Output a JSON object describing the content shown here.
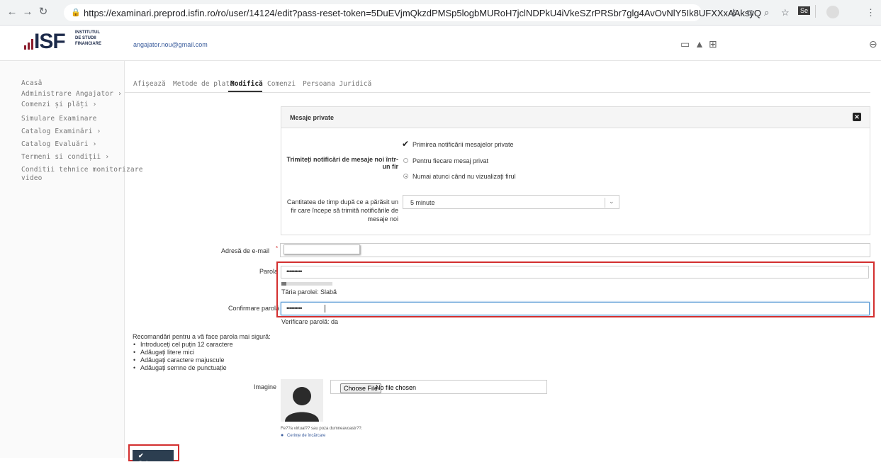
{
  "browser": {
    "url": "https://examinari.preprod.isfin.ro/ro/user/14124/edit?pass-reset-token=5DuEVjmQkzdPMSp5logbMURoH7jclNDPkU4iVkeSZrPRSbr7glg4AvOvNlY5Ik8UFXXxAAksyQ",
    "ext_label": "Se"
  },
  "header": {
    "logo_letters": "ISF",
    "logo_line1": "INSTITUTUL",
    "logo_line2": "DE STUDII",
    "logo_line3": "FINANCIARE",
    "email": "angajator.nou@gmail.com"
  },
  "sidebar": {
    "items": [
      {
        "label": "Acasă"
      },
      {
        "label": "Administrare Angajator  ›"
      },
      {
        "label": "Comenzi și plăți  ›"
      },
      {
        "label": "Simulare Examinare"
      },
      {
        "label": "Catalog Examinări  ›"
      },
      {
        "label": "Catalog Evaluări  ›"
      },
      {
        "label": "Termeni si condiții  ›"
      },
      {
        "label": "Conditii tehnice monitorizare"
      },
      {
        "label": "video"
      }
    ]
  },
  "tabs": [
    {
      "label": "Afișează"
    },
    {
      "label": "Metode de plată"
    },
    {
      "label": "Modifică"
    },
    {
      "label": "Comenzi"
    },
    {
      "label": "Persoana Juridică"
    }
  ],
  "pm": {
    "title": "Mesaje private",
    "checkbox_label": "Primirea notificării mesajelor private",
    "notify_label_line1": "Trimiteți notificări de mesaje noi într-",
    "notify_label_line2": "un fir",
    "radio1": "Pentru fiecare mesaj privat",
    "radio2": "Numai atunci când nu vizualizați firul",
    "time_label_line1": "Cantitatea de timp după ce a părăsit un",
    "time_label_line2": "fir care începe să trimită notificările de",
    "time_label_line3": "mesaje noi",
    "time_value": "5 minute"
  },
  "form": {
    "email_label": "Adresă de e-mail",
    "password_label": "Parola",
    "password_mask": "••••••••••",
    "strength_text": "Tăria parolei: Slabă",
    "strength_fraction": 0.1,
    "confirm_label": "Confirmare parolă",
    "confirm_mask": "••••••••••",
    "match_text": "Verificare parolă: da",
    "reco_title": "Recomandări pentru a vă face parola mai sigură:",
    "reco": [
      {
        "text": "Introduceți cel puțin 12 caractere"
      },
      {
        "text": "Adăugați litere mici"
      },
      {
        "text": "Adăugați caractere majuscule"
      },
      {
        "text": "Adăugați semne de punctuație"
      }
    ],
    "image_label": "Imagine",
    "choose_file": "Choose File",
    "no_file": "No file chosen",
    "avatar_note": "Fe??a virtual?? sau poza dumneavoastr??.",
    "upload_req": "Cerințe de încărcare",
    "save": "Salvare"
  },
  "colors": {
    "red_highlight": "#d32f2f",
    "link_blue": "#3a5c9c",
    "button_dark": "#2c3e50",
    "logo_red": "#8b1c2c",
    "logo_navy": "#1c2a4a"
  }
}
